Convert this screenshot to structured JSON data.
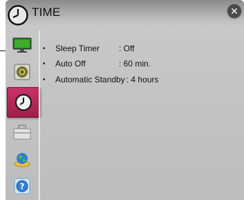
{
  "header": {
    "title": "TIME",
    "header_icon": "clock-icon",
    "close_icon": "close-icon"
  },
  "sidebar": {
    "items": [
      {
        "name": "picture",
        "icon": "monitor-icon"
      },
      {
        "name": "audio",
        "icon": "speaker-icon"
      },
      {
        "name": "time",
        "icon": "clock-icon",
        "active": true
      },
      {
        "name": "option",
        "icon": "toolbox-icon"
      },
      {
        "name": "network",
        "icon": "globe-icon"
      },
      {
        "name": "support",
        "icon": "help-icon"
      }
    ]
  },
  "settings": [
    {
      "label": "Sleep Timer",
      "value": ": Off"
    },
    {
      "label": "Auto Off",
      "value": ": 60 min."
    },
    {
      "label": "Automatic Standby",
      "value": ": 4 hours"
    }
  ],
  "colors": {
    "active_tab": "#b52658",
    "panel": "#c4c4c4",
    "close": "#4a4a4a"
  }
}
